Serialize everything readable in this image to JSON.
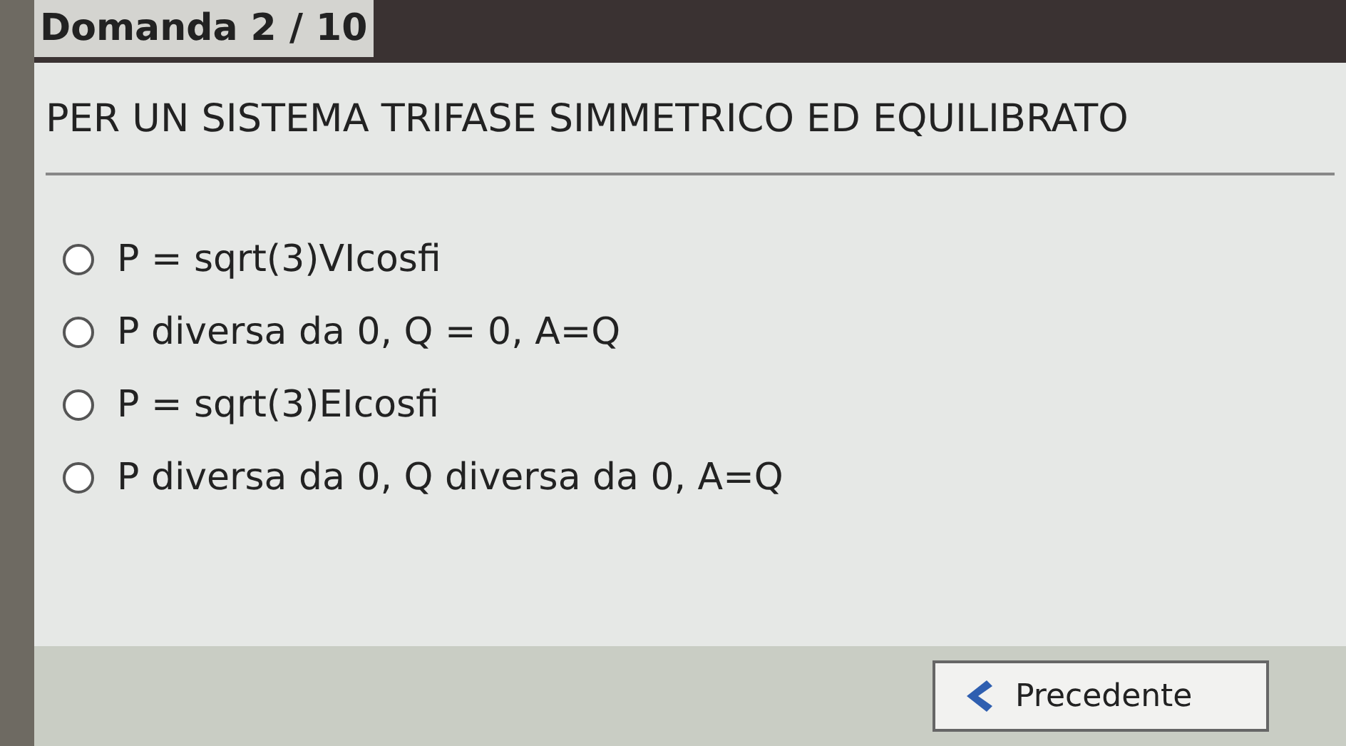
{
  "header": {
    "title": "Domanda 2 / 10"
  },
  "question": "PER UN SISTEMA TRIFASE SIMMETRICO ED EQUILIBRATO",
  "options": [
    {
      "label": "P = sqrt(3)VIcosfi",
      "selected": false
    },
    {
      "label": "P diversa da 0, Q = 0, A=Q",
      "selected": false
    },
    {
      "label": "P = sqrt(3)EIcosfi",
      "selected": false
    },
    {
      "label": "P diversa da 0, Q diversa da 0, A=Q",
      "selected": false
    }
  ],
  "buttons": [
    {
      "label": "Precedente"
    }
  ]
}
